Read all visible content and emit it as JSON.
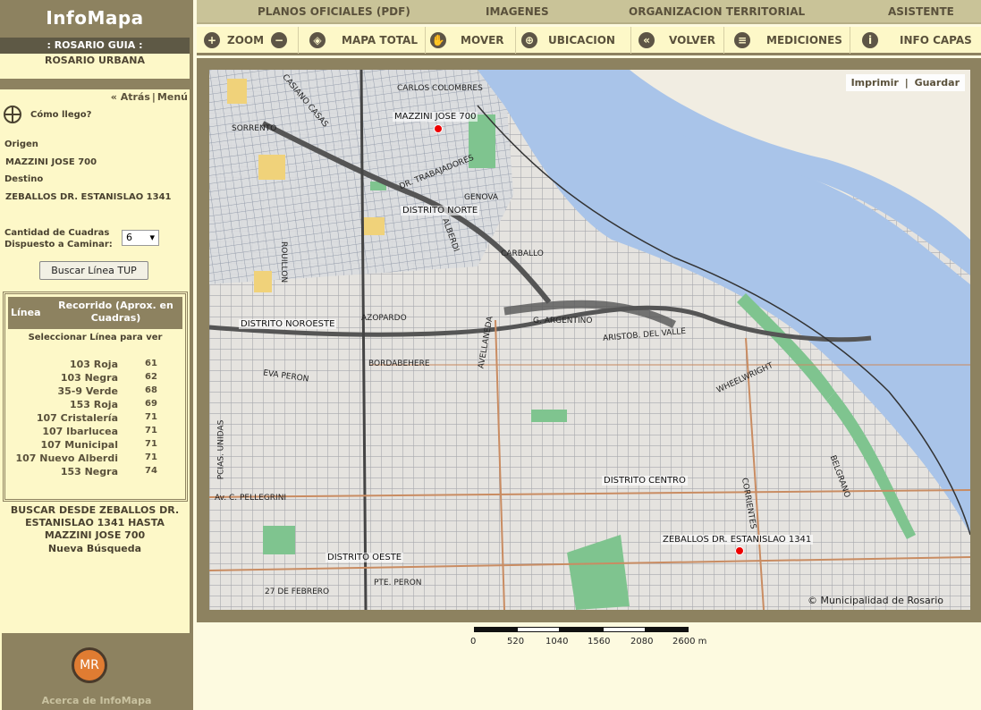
{
  "sidebar": {
    "brand": "InfoMapa",
    "guide_title": ":  ROSARIO GUIA  :",
    "guide_sub": "ROSARIO URBANA",
    "back": "« Atrás",
    "menu": "Menú",
    "howto": "Cómo llego?",
    "origin_label": "Origen",
    "origin_value": "MAZZINI JOSE 700",
    "dest_label": "Destino",
    "dest_value": "ZEBALLOS DR. ESTANISLAO 1341",
    "count_label_1": "Cantidad de Cuadras",
    "count_label_2": "Dispuesto a Caminar:",
    "count_value": "6",
    "search_button": "Buscar Línea TUP",
    "lines_header_line": "Línea",
    "lines_header_route": "Recorrido (Aprox. en Cuadras)",
    "lines_note": "Seleccionar Línea para ver",
    "lines": [
      {
        "name": "103 Roja",
        "blocks": "61"
      },
      {
        "name": "103 Negra",
        "blocks": "62"
      },
      {
        "name": "35-9 Verde",
        "blocks": "68"
      },
      {
        "name": "153 Roja",
        "blocks": "69"
      },
      {
        "name": "107 Cristalería",
        "blocks": "71"
      },
      {
        "name": "107 Ibarlucea",
        "blocks": "71"
      },
      {
        "name": "107 Municipal",
        "blocks": "71"
      },
      {
        "name": "107 Nuevo Alberdi",
        "blocks": "71"
      },
      {
        "name": "153 Negra",
        "blocks": "74"
      }
    ],
    "search_summary": "BUSCAR DESDE   ZEBALLOS DR. ESTANISLAO 1341 HASTA MAZZINI JOSE 700",
    "new_search": "Nueva Búsqueda",
    "about_logo": "MR",
    "about_link": "Acerca de InfoMapa"
  },
  "topmenu": [
    "PLANOS OFICIALES (PDF)",
    "IMAGENES",
    "ORGANIZACION TERRITORIAL",
    "ASISTENTE"
  ],
  "toolbar": [
    {
      "icon": "zoom-icon",
      "label": "ZOOM"
    },
    {
      "icon": "full-map-icon",
      "label": "MAPA TOTAL"
    },
    {
      "icon": "hand-icon",
      "label": "MOVER"
    },
    {
      "icon": "location-icon",
      "label": "UBICACION"
    },
    {
      "icon": "back-icon",
      "label": "VOLVER"
    },
    {
      "icon": "measure-icon",
      "label": "MEDICIONES"
    },
    {
      "icon": "info-icon",
      "label": "INFO CAPAS"
    }
  ],
  "map": {
    "print": "Imprimir",
    "save": "Guardar",
    "origin_marker": "MAZZINI JOSE 700",
    "dest_marker": "ZEBALLOS DR. ESTANISLAO 1341",
    "districts": [
      "DISTRITO NORTE",
      "DISTRITO NOROESTE",
      "DISTRITO CENTRO",
      "DISTRITO OESTE"
    ],
    "streets": [
      "CARLOS COLOMBRES",
      "CASIANO CASAS",
      "SORRENTO",
      "DR. TRABAJADORES",
      "GENOVA",
      "CARBALLO",
      "AZOPARDO",
      "BORDABEHERE",
      "EVA PERON",
      "ARISTOB. DEL VALLE",
      "WHEELWRIGHT",
      "BELGRANO",
      "Av. C. PELLEGRINI",
      "27 DE FEBRERO",
      "PTE. PERON",
      "CORRIENTES",
      "AVELLANEDA",
      "ALBERDI",
      "ROUILLON",
      "PCIAS. UNIDAS",
      "G. ARGENTINO"
    ],
    "copyright": "© Municipalidad de Rosario"
  },
  "scale": {
    "labels": [
      "0",
      "520",
      "1040",
      "1560",
      "2080",
      "2600 m"
    ]
  }
}
